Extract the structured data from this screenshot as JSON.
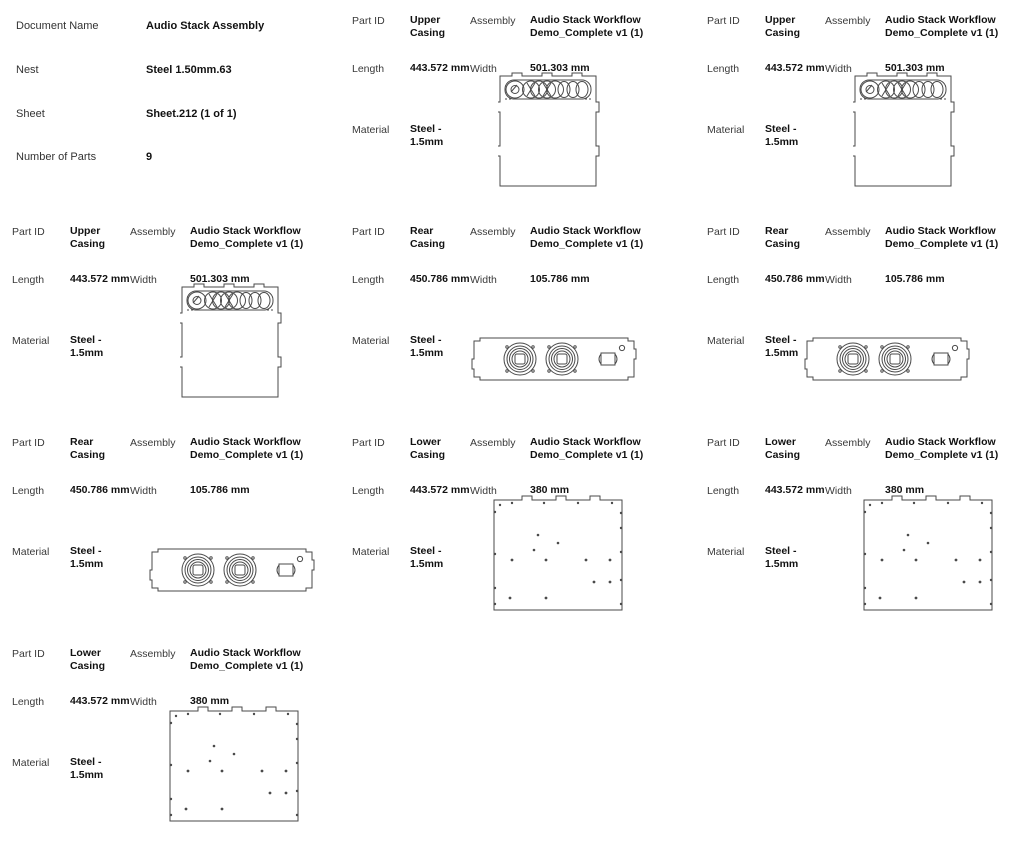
{
  "document": {
    "fields": [
      {
        "label": "Document Name",
        "value": "Audio Stack Assembly"
      },
      {
        "label": "Nest",
        "value": "Steel 1.50mm.63"
      },
      {
        "label": "Sheet",
        "value": "Sheet.212 (1 of 1)"
      },
      {
        "label": "Number of Parts",
        "value": "9"
      }
    ]
  },
  "field_labels": {
    "part_id": "Part ID",
    "assembly": "Assembly",
    "length": "Length",
    "width": "Width",
    "material": "Material"
  },
  "parts": [
    {
      "part_id": "Upper Casing",
      "assembly": "Audio Stack Workflow Demo_Complete v1 (1)",
      "length": "443.572 mm",
      "width": "501.303 mm",
      "material": "Steel - 1.5mm",
      "drawing": "upper-casing-outline"
    },
    {
      "part_id": "Upper Casing",
      "assembly": "Audio Stack Workflow Demo_Complete v1 (1)",
      "length": "443.572 mm",
      "width": "501.303 mm",
      "material": "Steel - 1.5mm",
      "drawing": "upper-casing-outline"
    },
    {
      "part_id": "Upper Casing",
      "assembly": "Audio Stack Workflow Demo_Complete v1 (1)",
      "length": "443.572 mm",
      "width": "501.303 mm",
      "material": "Steel - 1.5mm",
      "drawing": "upper-casing-outline"
    },
    {
      "part_id": "Rear Casing",
      "assembly": "Audio Stack Workflow Demo_Complete v1 (1)",
      "length": "450.786 mm",
      "width": "105.786 mm",
      "material": "Steel - 1.5mm",
      "drawing": "rear-casing-outline"
    },
    {
      "part_id": "Rear Casing",
      "assembly": "Audio Stack Workflow Demo_Complete v1 (1)",
      "length": "450.786 mm",
      "width": "105.786 mm",
      "material": "Steel - 1.5mm",
      "drawing": "rear-casing-outline"
    },
    {
      "part_id": "Rear Casing",
      "assembly": "Audio Stack Workflow Demo_Complete v1 (1)",
      "length": "450.786 mm",
      "width": "105.786 mm",
      "material": "Steel - 1.5mm",
      "drawing": "rear-casing-outline"
    },
    {
      "part_id": "Lower Casing",
      "assembly": "Audio Stack Workflow Demo_Complete v1 (1)",
      "length": "443.572 mm",
      "width": "380 mm",
      "material": "Steel - 1.5mm",
      "drawing": "lower-casing-outline"
    },
    {
      "part_id": "Lower Casing",
      "assembly": "Audio Stack Workflow Demo_Complete v1 (1)",
      "length": "443.572 mm",
      "width": "380 mm",
      "material": "Steel - 1.5mm",
      "drawing": "lower-casing-outline"
    },
    {
      "part_id": "Lower Casing",
      "assembly": "Audio Stack Workflow Demo_Complete v1 (1)",
      "length": "443.572 mm",
      "width": "380 mm",
      "material": "Steel - 1.5mm",
      "drawing": "lower-casing-outline"
    }
  ],
  "colors": {
    "background": "#ffffff",
    "label_text": "#3a3a3a",
    "value_text": "#111111",
    "drawing_line": "#4a4a4a"
  }
}
